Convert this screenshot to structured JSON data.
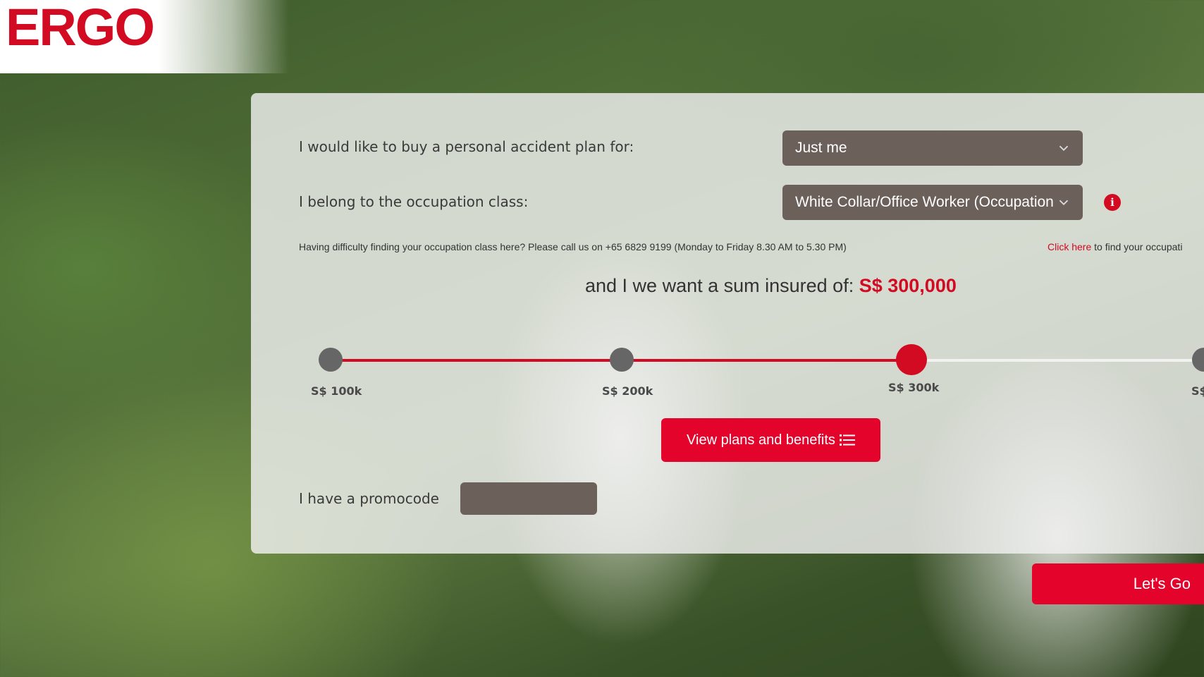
{
  "brand": {
    "logo_text": "ERGO",
    "accent_color": "#d20a22"
  },
  "form": {
    "plan_for_label": "I would like to buy a personal accident plan for:",
    "plan_for_value": "Just me",
    "occupation_label": "I belong to the occupation class:",
    "occupation_value": "White Collar/Office Worker (Occupation",
    "help_text": "Having difficulty finding your occupation class here? Please call us on +65 6829 9199 (Monday to Friday 8.30 AM to 5.30 PM)",
    "click_here_link": "Click here",
    "click_here_suffix": " to find your occupati",
    "sum_insured_prefix": "and I we want a sum insured of:",
    "sum_insured_value": "S$ 300,000",
    "promo_label": "I have a promocode",
    "promo_value": ""
  },
  "slider": {
    "ticks": [
      "S$ 100k",
      "S$ 200k",
      "S$ 300k",
      "S$"
    ],
    "selected_index": 2
  },
  "buttons": {
    "view_plans": "View plans and benefits",
    "lets_go": "Let's Go"
  },
  "icons": {
    "dropdown": "chevron-down-icon",
    "info": "info-icon",
    "list": "list-icon"
  }
}
